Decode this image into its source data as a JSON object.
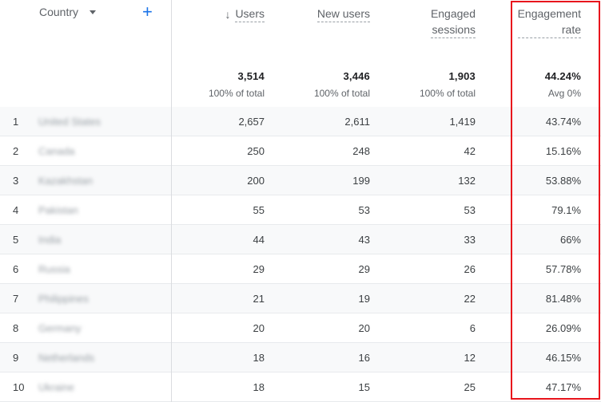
{
  "header": {
    "country_label": "Country",
    "add_label": "+",
    "columns": [
      {
        "label": "Users",
        "total": "3,514",
        "sub": "100% of total"
      },
      {
        "label": "New users",
        "total": "3,446",
        "sub": "100% of total"
      },
      {
        "label": "Engaged\nsessions",
        "total": "1,903",
        "sub": "100% of total"
      },
      {
        "label": "Engagement\nrate",
        "total": "44.24%",
        "sub": "Avg 0%"
      }
    ],
    "sort_icon": "arrow-down-icon"
  },
  "rows": [
    {
      "n": "1",
      "country": "United States",
      "users": "2,657",
      "new_users": "2,611",
      "engaged": "1,419",
      "rate": "43.74%"
    },
    {
      "n": "2",
      "country": "Canada",
      "users": "250",
      "new_users": "248",
      "engaged": "42",
      "rate": "15.16%"
    },
    {
      "n": "3",
      "country": "Kazakhstan",
      "users": "200",
      "new_users": "199",
      "engaged": "132",
      "rate": "53.88%"
    },
    {
      "n": "4",
      "country": "Pakistan",
      "users": "55",
      "new_users": "53",
      "engaged": "53",
      "rate": "79.1%"
    },
    {
      "n": "5",
      "country": "India",
      "users": "44",
      "new_users": "43",
      "engaged": "33",
      "rate": "66%"
    },
    {
      "n": "6",
      "country": "Russia",
      "users": "29",
      "new_users": "29",
      "engaged": "26",
      "rate": "57.78%"
    },
    {
      "n": "7",
      "country": "Philippines",
      "users": "21",
      "new_users": "19",
      "engaged": "22",
      "rate": "81.48%"
    },
    {
      "n": "8",
      "country": "Germany",
      "users": "20",
      "new_users": "20",
      "engaged": "6",
      "rate": "26.09%"
    },
    {
      "n": "9",
      "country": "Netherlands",
      "users": "18",
      "new_users": "16",
      "engaged": "12",
      "rate": "46.15%"
    },
    {
      "n": "10",
      "country": "Ukraine",
      "users": "18",
      "new_users": "15",
      "engaged": "25",
      "rate": "47.17%"
    }
  ],
  "colors": {
    "accent": "#1a73e8",
    "highlight": "#e8141c",
    "row_alt": "#f8f9fa"
  }
}
